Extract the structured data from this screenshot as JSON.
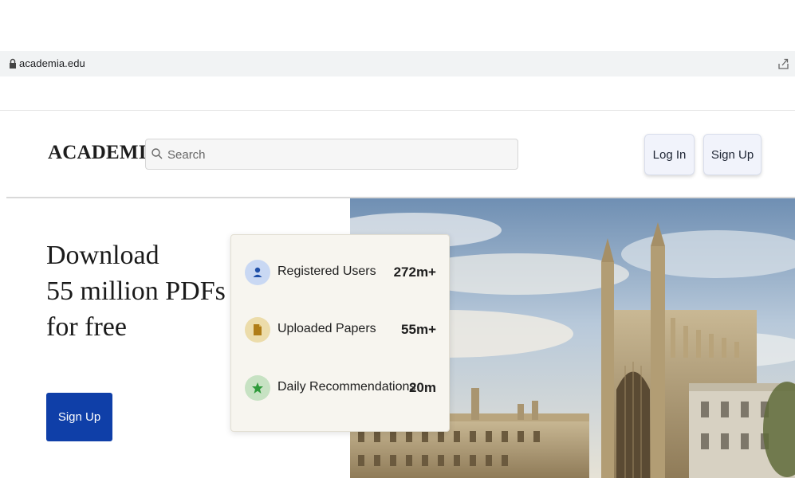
{
  "browser": {
    "url": "academia.edu",
    "icons": {
      "lock": "lock-icon",
      "share": "share-icon"
    }
  },
  "header": {
    "logo": "ACADEMIA",
    "search": {
      "placeholder": "Search",
      "icon": "search-icon"
    },
    "login_label": "Log In",
    "signup_label": "Sign Up"
  },
  "hero": {
    "title_lines": [
      "Download",
      "55 million PDFs",
      "for free"
    ],
    "signup_label": "Sign Up"
  },
  "stats": [
    {
      "label": "Registered Users",
      "value": "272m+",
      "icon": "user-icon",
      "icon_bg": "#c9d8f3",
      "icon_color": "#1f4fa8"
    },
    {
      "label": "Uploaded Papers",
      "value": "55m+",
      "icon": "document-icon",
      "icon_bg": "#ecdcaa",
      "icon_color": "#b07d17"
    },
    {
      "label": "Daily Recommendations",
      "value": "20m",
      "icon": "star-icon",
      "icon_bg": "#c7e2c3",
      "icon_color": "#2e9a3a"
    }
  ],
  "colors": {
    "accent": "#0f3fa8",
    "header_button_bg": "#f1f3fb",
    "card_bg": "#f7f5ef"
  }
}
